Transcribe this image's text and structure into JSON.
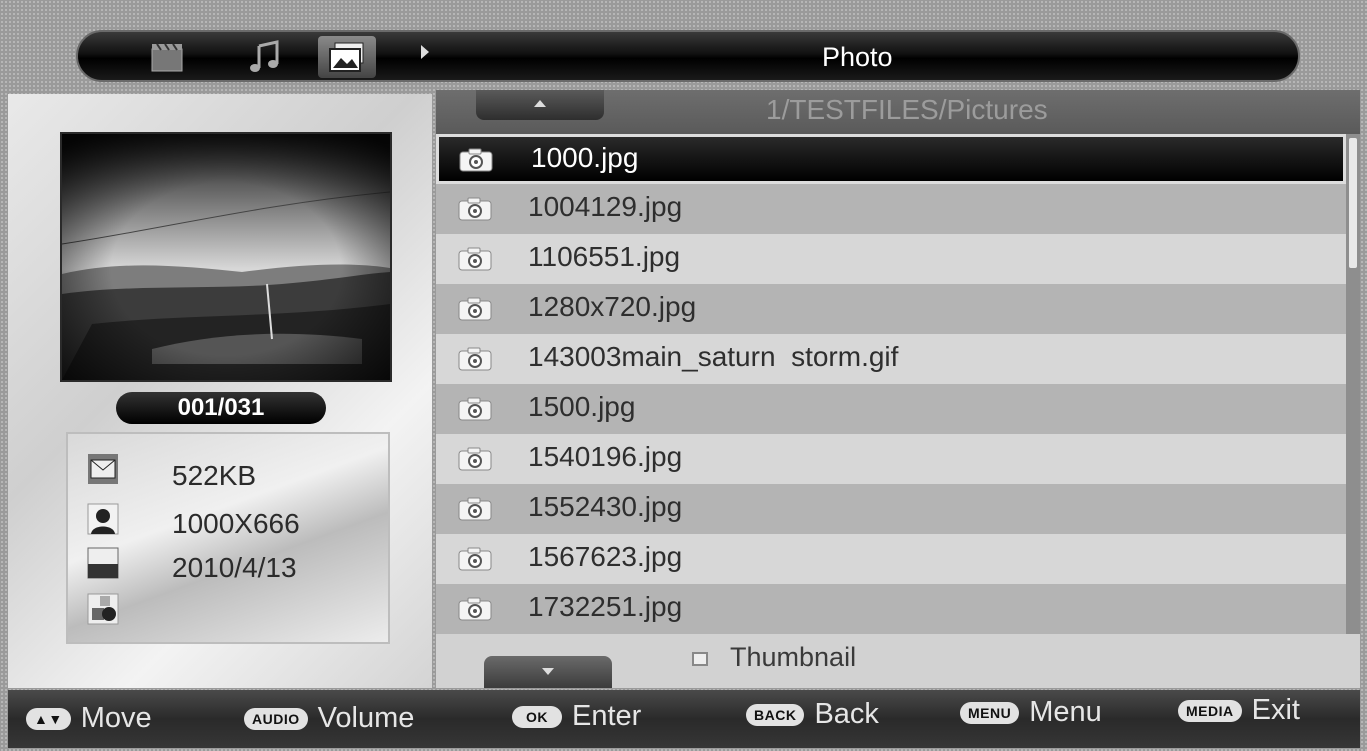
{
  "header": {
    "tabs": [
      {
        "name": "movie-tab",
        "icon": "film-clapper-icon"
      },
      {
        "name": "music-tab",
        "icon": "music-note-icon"
      },
      {
        "name": "photo-tab",
        "icon": "picture-icon",
        "active": true
      }
    ],
    "title": "Photo"
  },
  "path": "1/TESTFILES/Pictures",
  "preview": {
    "counter": "001/031",
    "info": {
      "size": "522KB",
      "resolution": "1000X666",
      "date": "2010/4/13"
    }
  },
  "files": [
    "1000.jpg",
    "1004129.jpg",
    "1106551.jpg",
    "1280x720.jpg",
    "143003main_saturn  storm.gif",
    "1500.jpg",
    "1540196.jpg",
    "1552430.jpg",
    "1567623.jpg",
    "1732251.jpg"
  ],
  "selected_index": 0,
  "thumbnail_label": "Thumbnail",
  "footer": {
    "hints": [
      {
        "key": "▲▼",
        "label": "Move"
      },
      {
        "key": "AUDIO",
        "label": "Volume"
      },
      {
        "key": "OK",
        "label": "Enter"
      },
      {
        "key": "BACK",
        "label": "Back"
      },
      {
        "key": "MENU",
        "label": "Menu"
      },
      {
        "key": "MEDIA",
        "label": "Exit"
      }
    ]
  },
  "colors": {
    "selected_row": "#000000",
    "row_dark": "#b4b4b4",
    "row_light": "#d7d7d7"
  }
}
